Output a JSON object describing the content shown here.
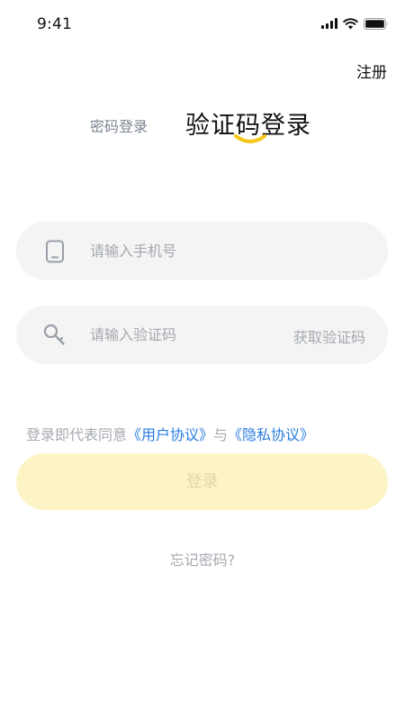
{
  "status_bar": {
    "time": "9:41"
  },
  "header": {
    "register_label": "注册"
  },
  "tabs": [
    {
      "label": "密码登录",
      "active": false
    },
    {
      "label": "验证码登录",
      "active": true
    }
  ],
  "form": {
    "phone_placeholder": "请输入手机号",
    "code_placeholder": "请输入验证码",
    "get_code_label": "获取验证码"
  },
  "agreement": {
    "prefix": "登录即代表同意",
    "user_agreement": "《用户协议》",
    "connector": "与",
    "privacy_policy": "《隐私协议》"
  },
  "actions": {
    "login_label": "登录",
    "forgot_label": "忘记密码?"
  },
  "icons": {
    "phone": "phone-icon",
    "key": "key-icon",
    "signal": "signal-icon",
    "wifi": "wifi-icon",
    "battery": "battery-icon"
  },
  "colors": {
    "accent_yellow": "#f5c518",
    "link_blue": "#2a7ce0",
    "login_button_bg": "#fdf4c6",
    "input_bg": "#f4f4f4",
    "placeholder_gray": "#a5a9b0"
  }
}
